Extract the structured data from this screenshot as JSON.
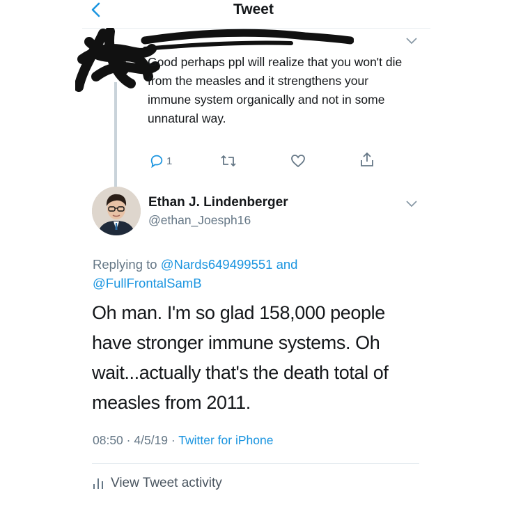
{
  "header": {
    "title": "Tweet"
  },
  "parent_tweet": {
    "text": "Good perhaps ppl will realize that you won't die from the measles and it strengthens your immune system organically and not in some unnatural way.",
    "reply_count": "1"
  },
  "tweet": {
    "author_name": "Ethan J. Lindenberger",
    "author_handle": "@ethan_Joesph16",
    "replying_to_prefix": "Replying to",
    "replying_to_user1": "@Nards649499551",
    "replying_to_and": "and",
    "replying_to_user2": "@FullFrontalSamB",
    "text": "Oh man. I'm so glad 158,000 people have stronger immune systems. Oh wait...actually that's the death total of measles from 2011.",
    "time": "08:50",
    "date": "4/5/19",
    "source": "Twitter for iPhone",
    "dot": "·"
  },
  "footer": {
    "activity_label": "View Tweet activity"
  },
  "colors": {
    "link": "#1b95e0",
    "secondary": "#657786",
    "text": "#14171a"
  }
}
